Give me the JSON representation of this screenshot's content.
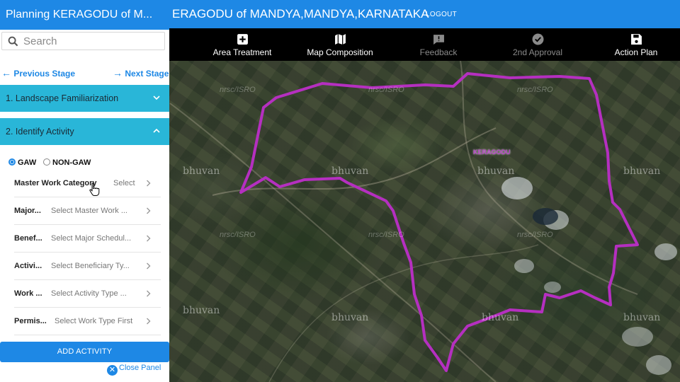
{
  "header": {
    "title": "ERAGODU of MANDYA,MANDYA,KARNATAKA",
    "logout_label": "LOGOUT",
    "accent_color": "#1e88e5"
  },
  "toolbar": {
    "items": [
      {
        "label": "Area Treatment",
        "icon": "plus-square-icon",
        "enabled": true
      },
      {
        "label": "Map Composition",
        "icon": "map-icon",
        "enabled": true
      },
      {
        "label": "Feedback",
        "icon": "feedback-icon",
        "enabled": false
      },
      {
        "label": "2nd Approval",
        "icon": "check-circle-icon",
        "enabled": false
      },
      {
        "label": "Action Plan",
        "icon": "save-icon",
        "enabled": true
      }
    ]
  },
  "panel": {
    "title": "Planning KERAGODU of M...",
    "search_placeholder": "Search",
    "previous_stage": "Previous Stage",
    "next_stage": "Next Stage",
    "sections": [
      {
        "label": "1. Landscape Familiarization",
        "expanded": false
      },
      {
        "label": "2. Identify Activity",
        "expanded": true
      }
    ],
    "radio_options": [
      {
        "label": "GAW",
        "selected": true
      },
      {
        "label": "NON-GAW",
        "selected": false
      }
    ],
    "fields": [
      {
        "label": "Master Work Category",
        "value": "Select"
      },
      {
        "label": "Major...",
        "value": "Select Master Work ..."
      },
      {
        "label": "Benef...",
        "value": "Select Major Schedul..."
      },
      {
        "label": "Activi...",
        "value": "Select Beneficiary Ty..."
      },
      {
        "label": "Work ...",
        "value": "Select Activity Type ..."
      },
      {
        "label": "Permis...",
        "value": "Select Work Type First"
      }
    ],
    "add_button": "ADD ACTIVITY",
    "close_label": "Close Panel",
    "section_color": "#29b6d8"
  },
  "map": {
    "watermark": "bhuvan",
    "credit": "nrsc/ISRO",
    "boundary_color": "#b52fc0",
    "village_label": "KERAGODU"
  }
}
